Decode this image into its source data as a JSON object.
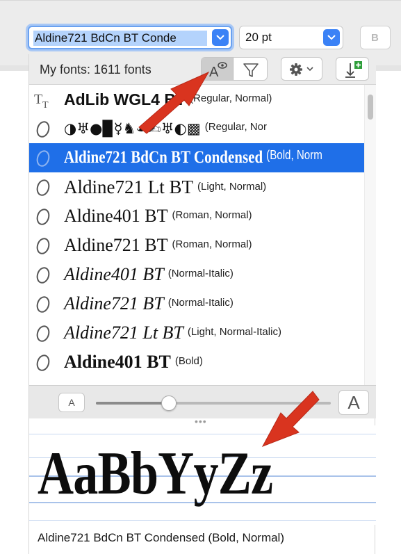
{
  "toolbar": {
    "font_value": "Aldine721 BdCn BT Conde",
    "size_value": "20 pt",
    "bold_label": "B"
  },
  "picker": {
    "count_label": "My fonts: 1611 fonts",
    "icons": [
      "font-preview-icon",
      "filter-icon",
      "gear-icon",
      "chevron-down-icon",
      "install-font-icon"
    ]
  },
  "fonts": [
    {
      "name": "AdLib WGL4 BT",
      "style": "(Regular, Normal)",
      "icon": "truetype-icon",
      "selected": false
    },
    {
      "name": "◑♅●▉☿♞☙✍♅◐▩",
      "style": "(Regular, Nor",
      "icon": "opentype-icon",
      "selected": false
    },
    {
      "name": "Aldine721 BdCn BT Condensed",
      "style": "(Bold, Norm",
      "icon": "opentype-icon",
      "selected": true
    },
    {
      "name": "Aldine721 Lt BT",
      "style": "(Light, Normal)",
      "icon": "opentype-icon",
      "selected": false
    },
    {
      "name": "Aldine401 BT",
      "style": "(Roman, Normal)",
      "icon": "opentype-icon",
      "selected": false
    },
    {
      "name": "Aldine721 BT",
      "style": "(Roman, Normal)",
      "icon": "opentype-icon",
      "selected": false
    },
    {
      "name": "Aldine401 BT",
      "style": "(Normal-Italic)",
      "icon": "opentype-icon",
      "selected": false
    },
    {
      "name": "Aldine721 BT",
      "style": "(Normal-Italic)",
      "icon": "opentype-icon",
      "selected": false
    },
    {
      "name": "Aldine721 Lt BT",
      "style": "(Light, Normal-Italic)",
      "icon": "opentype-icon",
      "selected": false
    },
    {
      "name": "Aldine401 BT",
      "style": "(Bold)",
      "icon": "opentype-icon",
      "selected": false
    }
  ],
  "zoom": {
    "small_label": "A",
    "large_label": "A",
    "level": 0.31
  },
  "preview": {
    "sample_text": "AaBbYyZz",
    "caption": "Aldine721 BdCn BT Condensed (Bold, Normal)"
  },
  "colors": {
    "selection": "#1f6fe8",
    "accent": "#3b82f6",
    "annotation_arrow": "#d9341f"
  }
}
